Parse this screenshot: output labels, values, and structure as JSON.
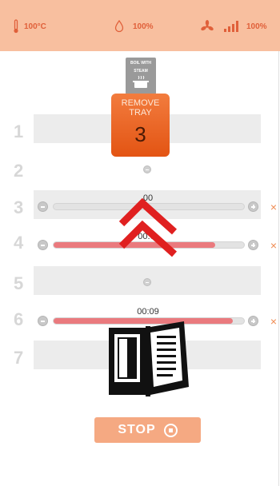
{
  "status": {
    "temperature": "100°C",
    "humidity": "100%",
    "fan_speed": "100%"
  },
  "program": {
    "boil_label_line1": "BOIL WITH",
    "boil_label_line2": "STEAM"
  },
  "remove_tray": {
    "label_line1": "REMOVE",
    "label_line2": "TRAY",
    "tray_number": "3"
  },
  "trays": [
    {
      "number": "1"
    },
    {
      "number": "2"
    },
    {
      "number": "3",
      "timer": "00",
      "progress": 0.0,
      "cancel": "×"
    },
    {
      "number": "4",
      "timer": "00:0",
      "progress": 0.85,
      "cancel": "×"
    },
    {
      "number": "5"
    },
    {
      "number": "6",
      "timer": "00:09",
      "progress": 0.94,
      "cancel": "×"
    },
    {
      "number": "7"
    }
  ],
  "stop_button": {
    "label": "STOP"
  },
  "colors": {
    "status_bar": "#f8bf9f",
    "accent": "#e35413",
    "progress": "#ea7a7e",
    "stop": "#f5a982"
  }
}
